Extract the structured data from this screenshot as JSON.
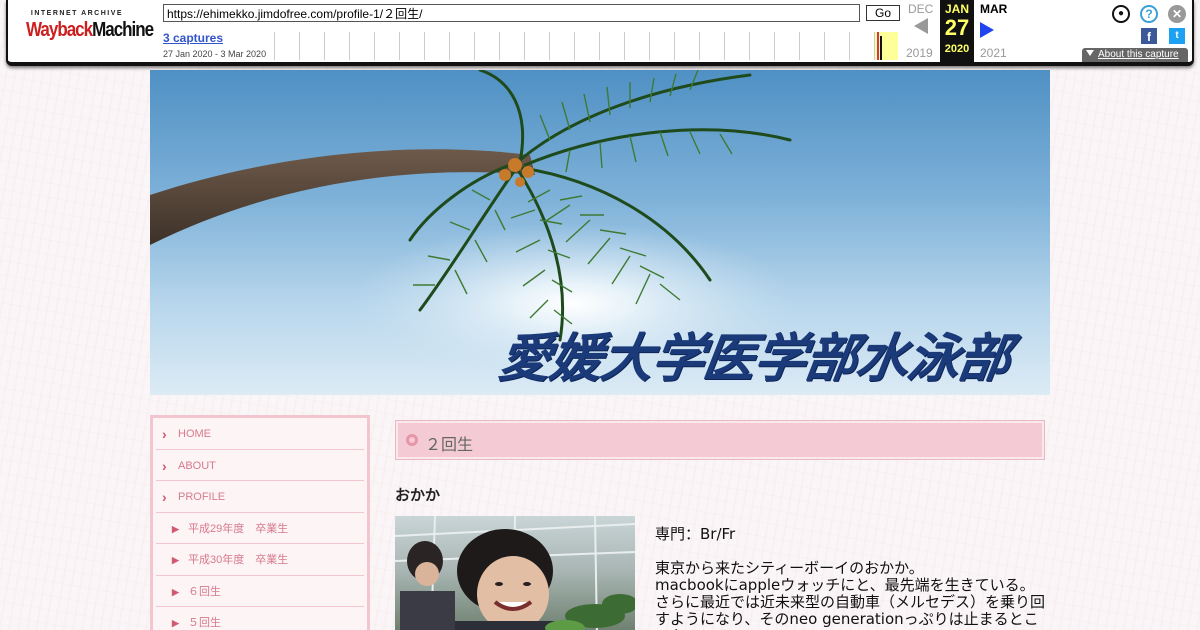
{
  "wayback": {
    "logo_top": "INTERNET ARCHIVE",
    "logo_wayback": "Wayback",
    "logo_machine": "Machine",
    "url": "https://ehimekko.jimdofree.com/profile-1/２回生/",
    "go_label": "Go",
    "captures": "3 captures",
    "range": "27 Jan 2020 - 3 Mar 2020",
    "prev_month": "DEC",
    "prev_year": "2019",
    "cur_month": "JAN",
    "cur_day": "27",
    "cur_year": "2020",
    "next_month": "MAR",
    "next_year": "2021",
    "about": "About this capture",
    "fb": "f",
    "tw": "t",
    "accent": "#ffff66"
  },
  "site": {
    "title": "愛媛大学医学部水泳部"
  },
  "nav": {
    "items": [
      {
        "label": "HOME",
        "sub": false
      },
      {
        "label": "ABOUT",
        "sub": false
      },
      {
        "label": "PROFILE",
        "sub": false
      },
      {
        "label": "平成29年度　卒業生",
        "sub": true
      },
      {
        "label": "平成30年度　卒業生",
        "sub": true
      },
      {
        "label": "６回生",
        "sub": true
      },
      {
        "label": "５回生",
        "sub": true
      }
    ],
    "accent": "#d67a8c"
  },
  "main": {
    "heading": "２回生",
    "person_name": "おかか",
    "specialty": "専門：Br/Fr",
    "bio_1": "東京から来たシティーボーイのおかか。",
    "bio_2": "macbookにappleウォッチにと、最先端を生きている。さらに最近では近未来型の自動車（メルセデス）を乗り回すようになり、そのneo generationっぷりは止まるところを"
  }
}
